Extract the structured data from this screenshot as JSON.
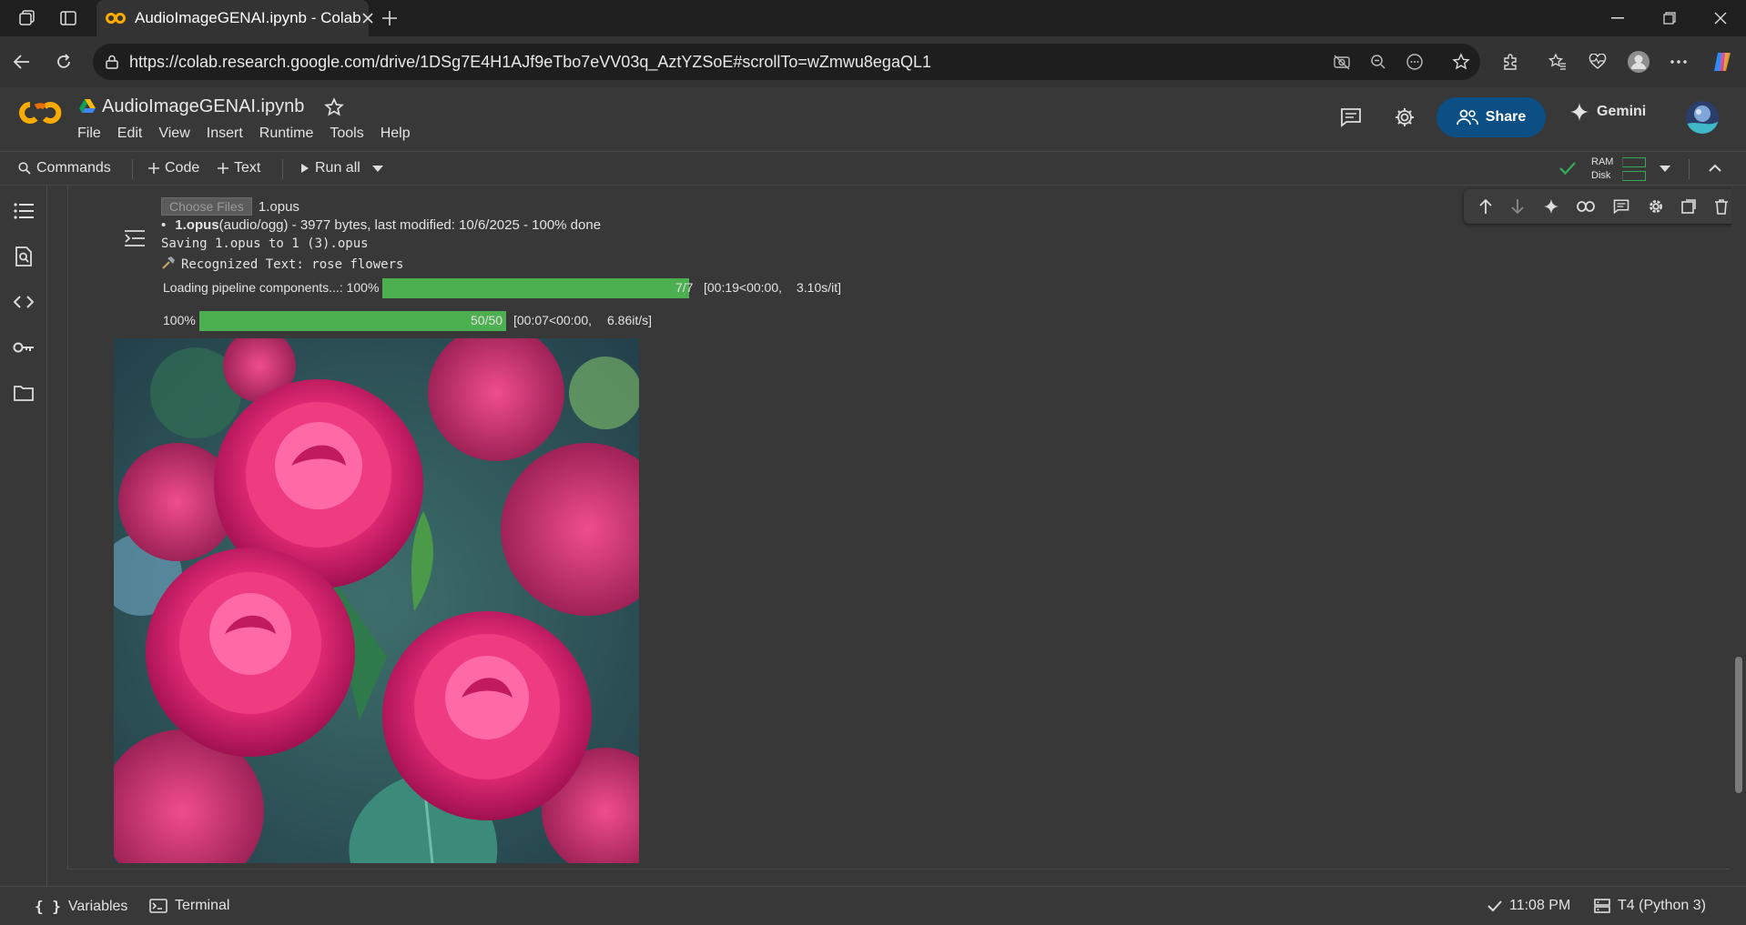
{
  "browser": {
    "tab_title": "AudioImageGENAI.ipynb - Colab",
    "url": "https://colab.research.google.com/drive/1DSg7E4H1AJf9eTbo7eVV03q_AztYZSoE#scrollTo=wZmwu8egaQL1"
  },
  "colab": {
    "notebook_title": "AudioImageGENAI.ipynb",
    "menu": [
      "File",
      "Edit",
      "View",
      "Insert",
      "Runtime",
      "Tools",
      "Help"
    ],
    "share_label": "Share",
    "gemini_label": "Gemini",
    "toolbar": {
      "commands": "Commands",
      "code": "Code",
      "text": "Text",
      "run_all": "Run all",
      "ram": "RAM",
      "disk": "Disk"
    }
  },
  "output": {
    "choose_files_label": "Choose Files",
    "chosen_file": "1.opus",
    "file_name": "1.opus",
    "file_info": "(audio/ogg) - 3977 bytes, last modified: 10/6/2025 - 100% done",
    "saving_line": "Saving 1.opus to 1 (3).opus",
    "recognized_line": "Recognized Text: rose flowers",
    "progress1": {
      "label": "Loading pipeline components...: 100%",
      "fraction": 1.0,
      "stats1": "7/7",
      "stats2": "[00:19<00:00,",
      "stats3": "3.10s/it]"
    },
    "progress2": {
      "label": "100%",
      "fraction": 1.0,
      "stats1": "50/50",
      "stats2": "[00:07<00:00,",
      "stats3": "6.86it/s]"
    }
  },
  "statusbar": {
    "variables": "Variables",
    "terminal": "Terminal",
    "time": "11:08 PM",
    "runtime": "T4 (Python 3)"
  },
  "colors": {
    "accent_blue": "#0b4f85",
    "progress_green": "#4caf50",
    "colab_orange": "#f9ab00",
    "check_green": "#34a853"
  }
}
